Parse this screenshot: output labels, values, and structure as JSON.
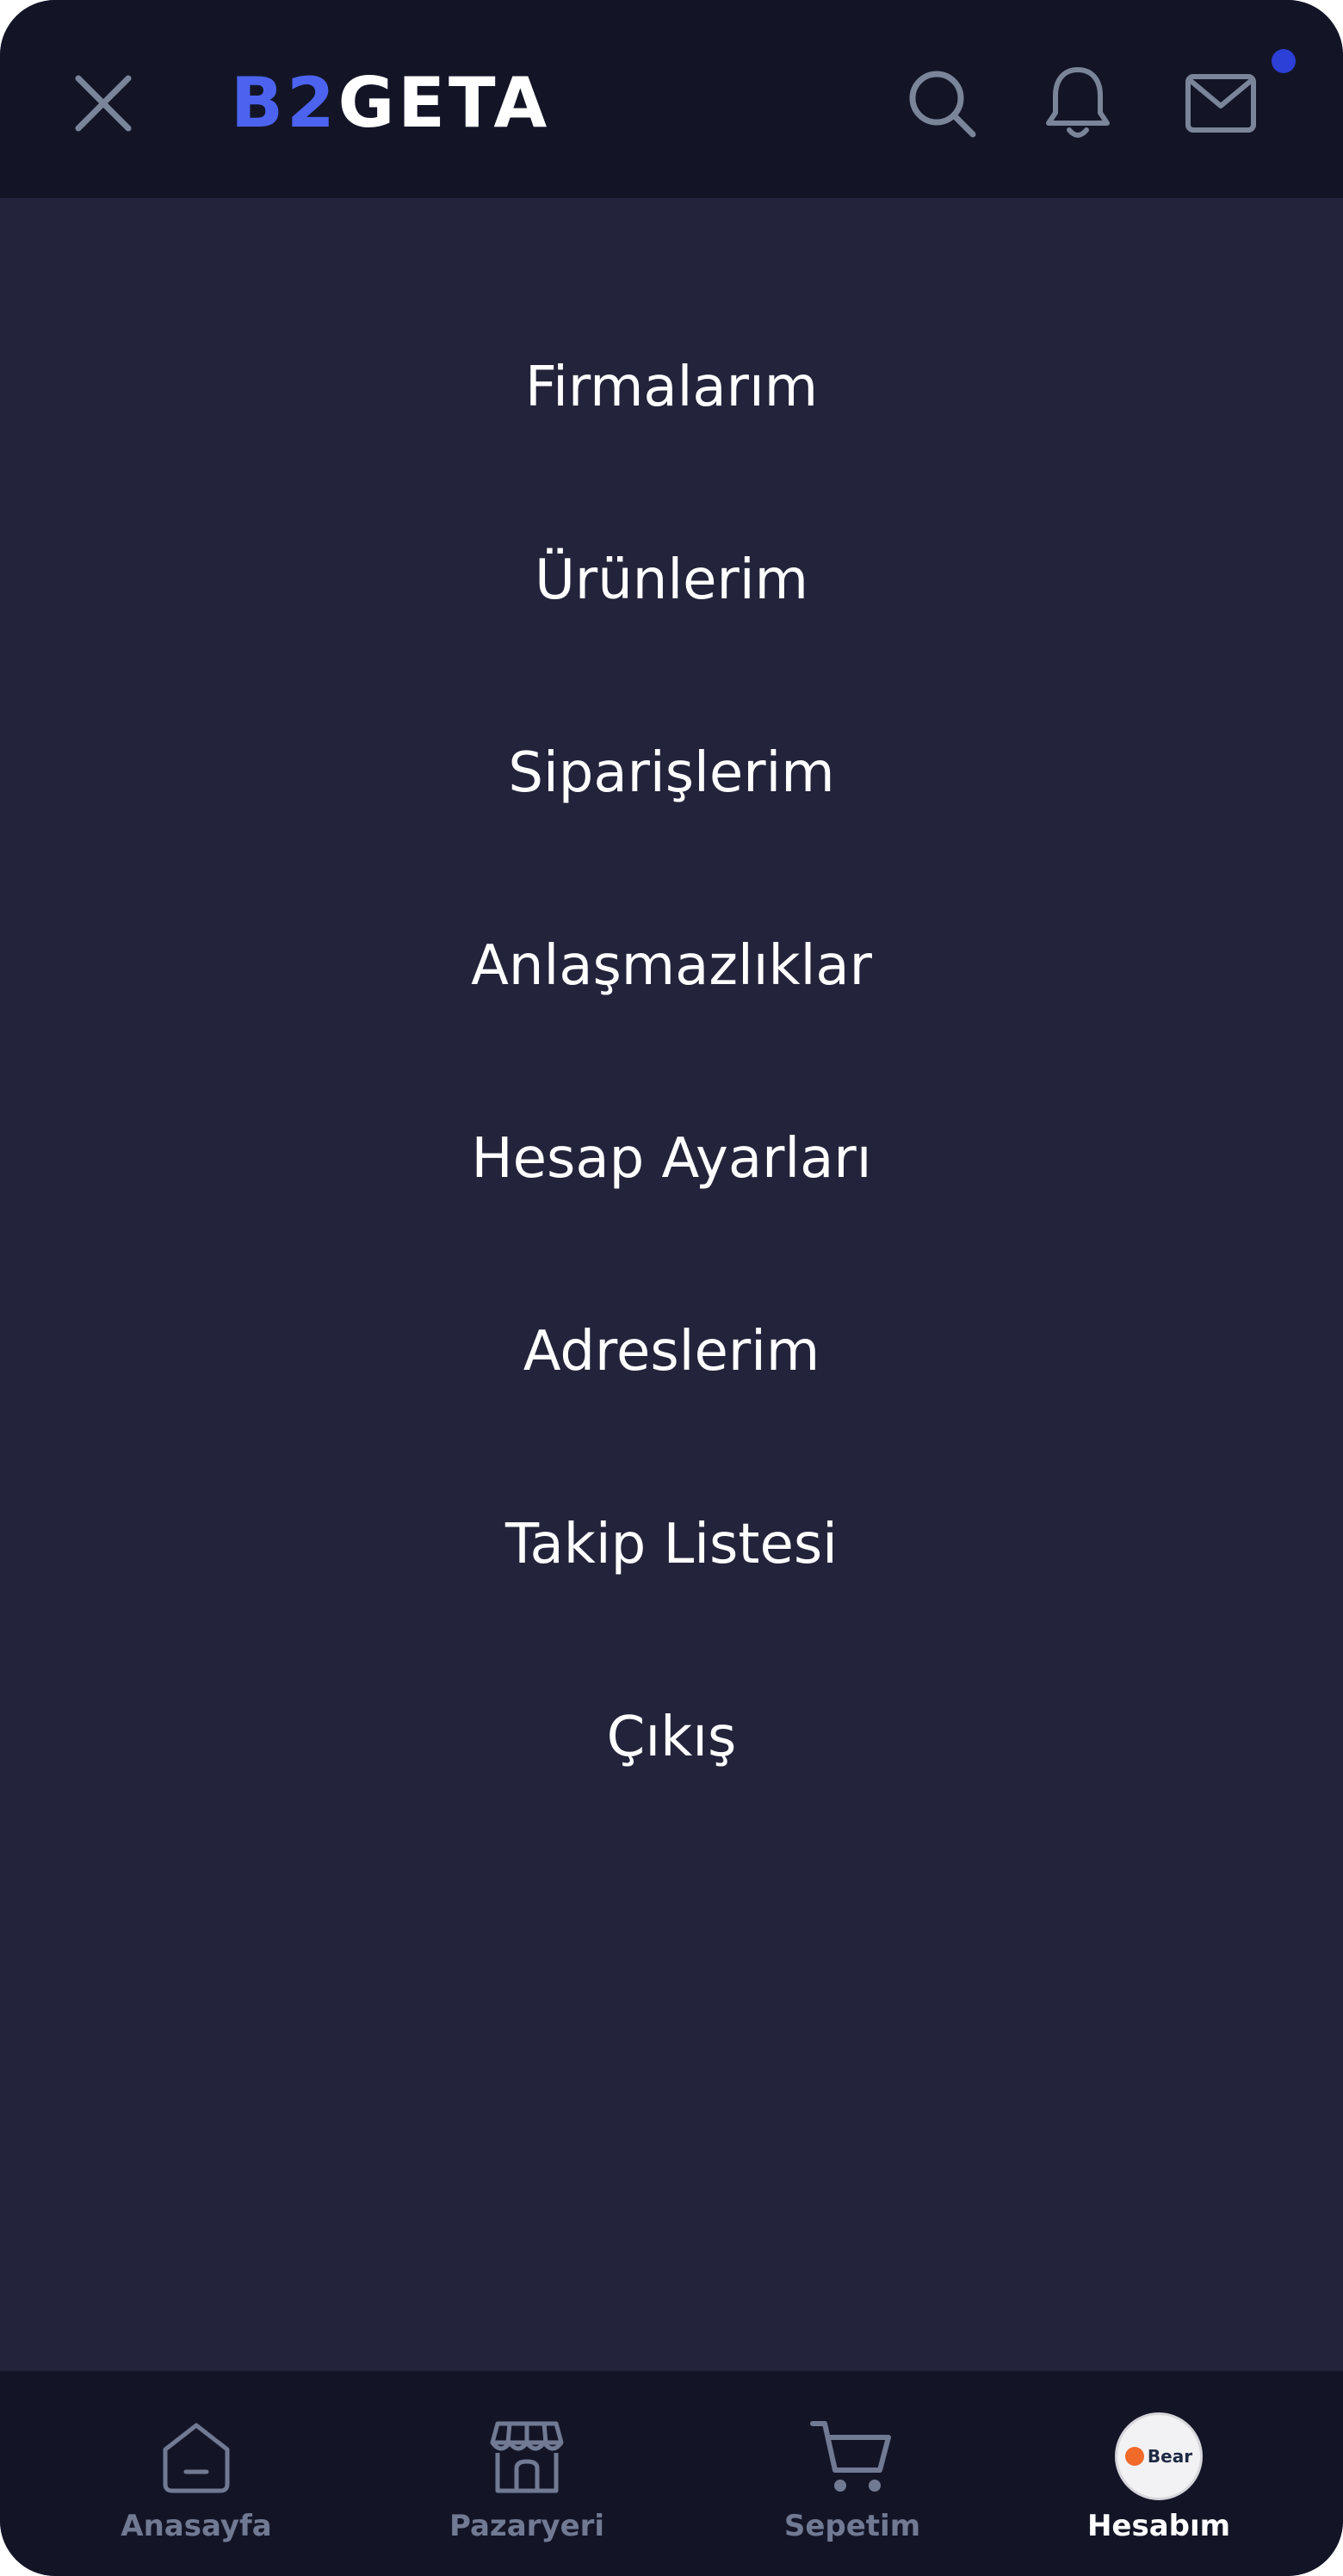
{
  "header": {
    "logo_part1": "B2",
    "logo_part2": "GETA",
    "accent_color": "#4c63f0",
    "icons": [
      "close-icon",
      "search-icon",
      "bell-icon",
      "mail-icon"
    ],
    "unread_dot_color": "#2c3fd6"
  },
  "menu": {
    "items": [
      {
        "label": "Firmalarım"
      },
      {
        "label": "Ürünlerim"
      },
      {
        "label": "Siparişlerim"
      },
      {
        "label": "Anlaşmazlıklar"
      },
      {
        "label": "Hesap Ayarları"
      },
      {
        "label": "Adreslerim"
      },
      {
        "label": "Takip Listesi"
      },
      {
        "label": "Çıkış"
      }
    ]
  },
  "bottom_nav": {
    "items": [
      {
        "label": "Anasayfa",
        "icon": "home-icon",
        "active": false
      },
      {
        "label": "Pazaryeri",
        "icon": "store-icon",
        "active": false
      },
      {
        "label": "Sepetim",
        "icon": "cart-icon",
        "active": false
      },
      {
        "label": "Hesabım",
        "icon": "avatar",
        "active": true
      }
    ],
    "avatar_brand": "Bear"
  },
  "colors": {
    "background": "#23243b",
    "bar_background": "#131527",
    "inactive": "#717a93",
    "text": "#ffffff"
  }
}
